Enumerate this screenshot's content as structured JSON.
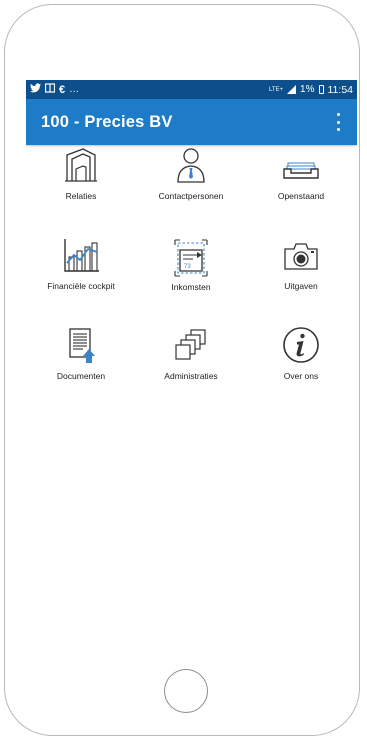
{
  "status_bar": {
    "left_icons": [
      "twitter-icon",
      "notes-icon",
      "euro-icon"
    ],
    "ellipsis": "…",
    "network": "LTE+",
    "battery": "1%",
    "time": "11:54"
  },
  "app_bar": {
    "title": "100 - Precies BV",
    "menu_icon": "more-vert-icon"
  },
  "tiles": [
    {
      "label": "Relaties",
      "icon": "building-icon"
    },
    {
      "label": "Contactpersonen",
      "icon": "person-icon"
    },
    {
      "label": "Openstaand",
      "icon": "tray-icon"
    },
    {
      "label": "Financiële cockpit",
      "icon": "chart-icon"
    },
    {
      "label": "Inkomsten",
      "icon": "invoice-icon"
    },
    {
      "label": "Uitgaven",
      "icon": "camera-icon"
    },
    {
      "label": "Documenten",
      "icon": "document-upload-icon"
    },
    {
      "label": "Administraties",
      "icon": "stacked-pages-icon"
    },
    {
      "label": "Over ons",
      "icon": "info-icon"
    }
  ],
  "colors": {
    "status_bar": "#0c4f8a",
    "app_bar": "#1e7bc7",
    "icon_stroke": "#333333",
    "icon_accent": "#3c83c9"
  }
}
